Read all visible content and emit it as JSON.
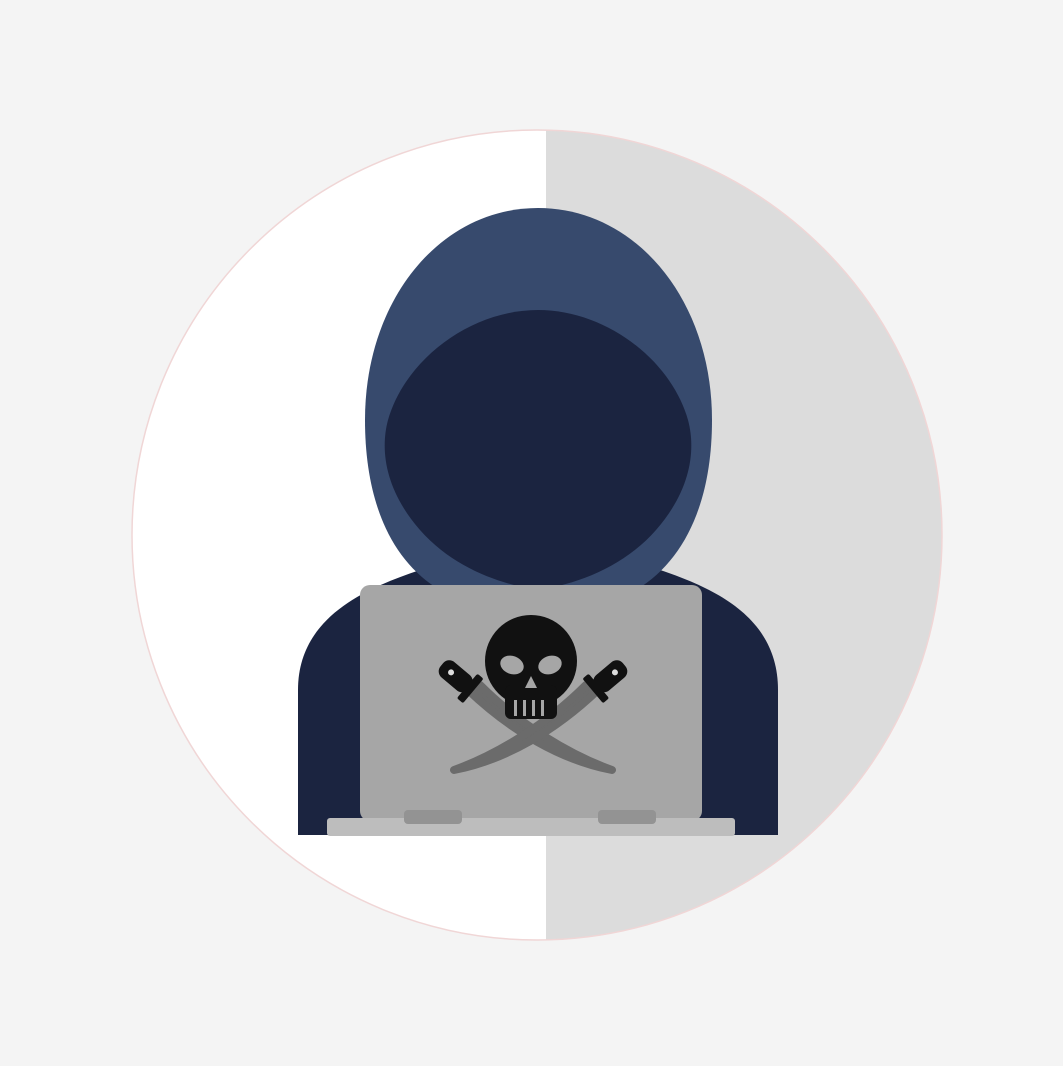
{
  "illustration": {
    "subject": "hooded-hacker-with-laptop",
    "laptop_emblem": "skull-and-crossed-swords",
    "colors": {
      "page_background": "#f4f4f4",
      "circle_left": "#ffffff",
      "circle_right": "#dcdcdc",
      "hood_outer": "#374a6d",
      "hood_inner": "#1b2440",
      "laptop_lid": "#a6a6a6",
      "laptop_base": "#bdbdbd",
      "laptop_feet": "#939393",
      "skull": "#111111",
      "sword_blade": "#6b6b6b"
    }
  }
}
